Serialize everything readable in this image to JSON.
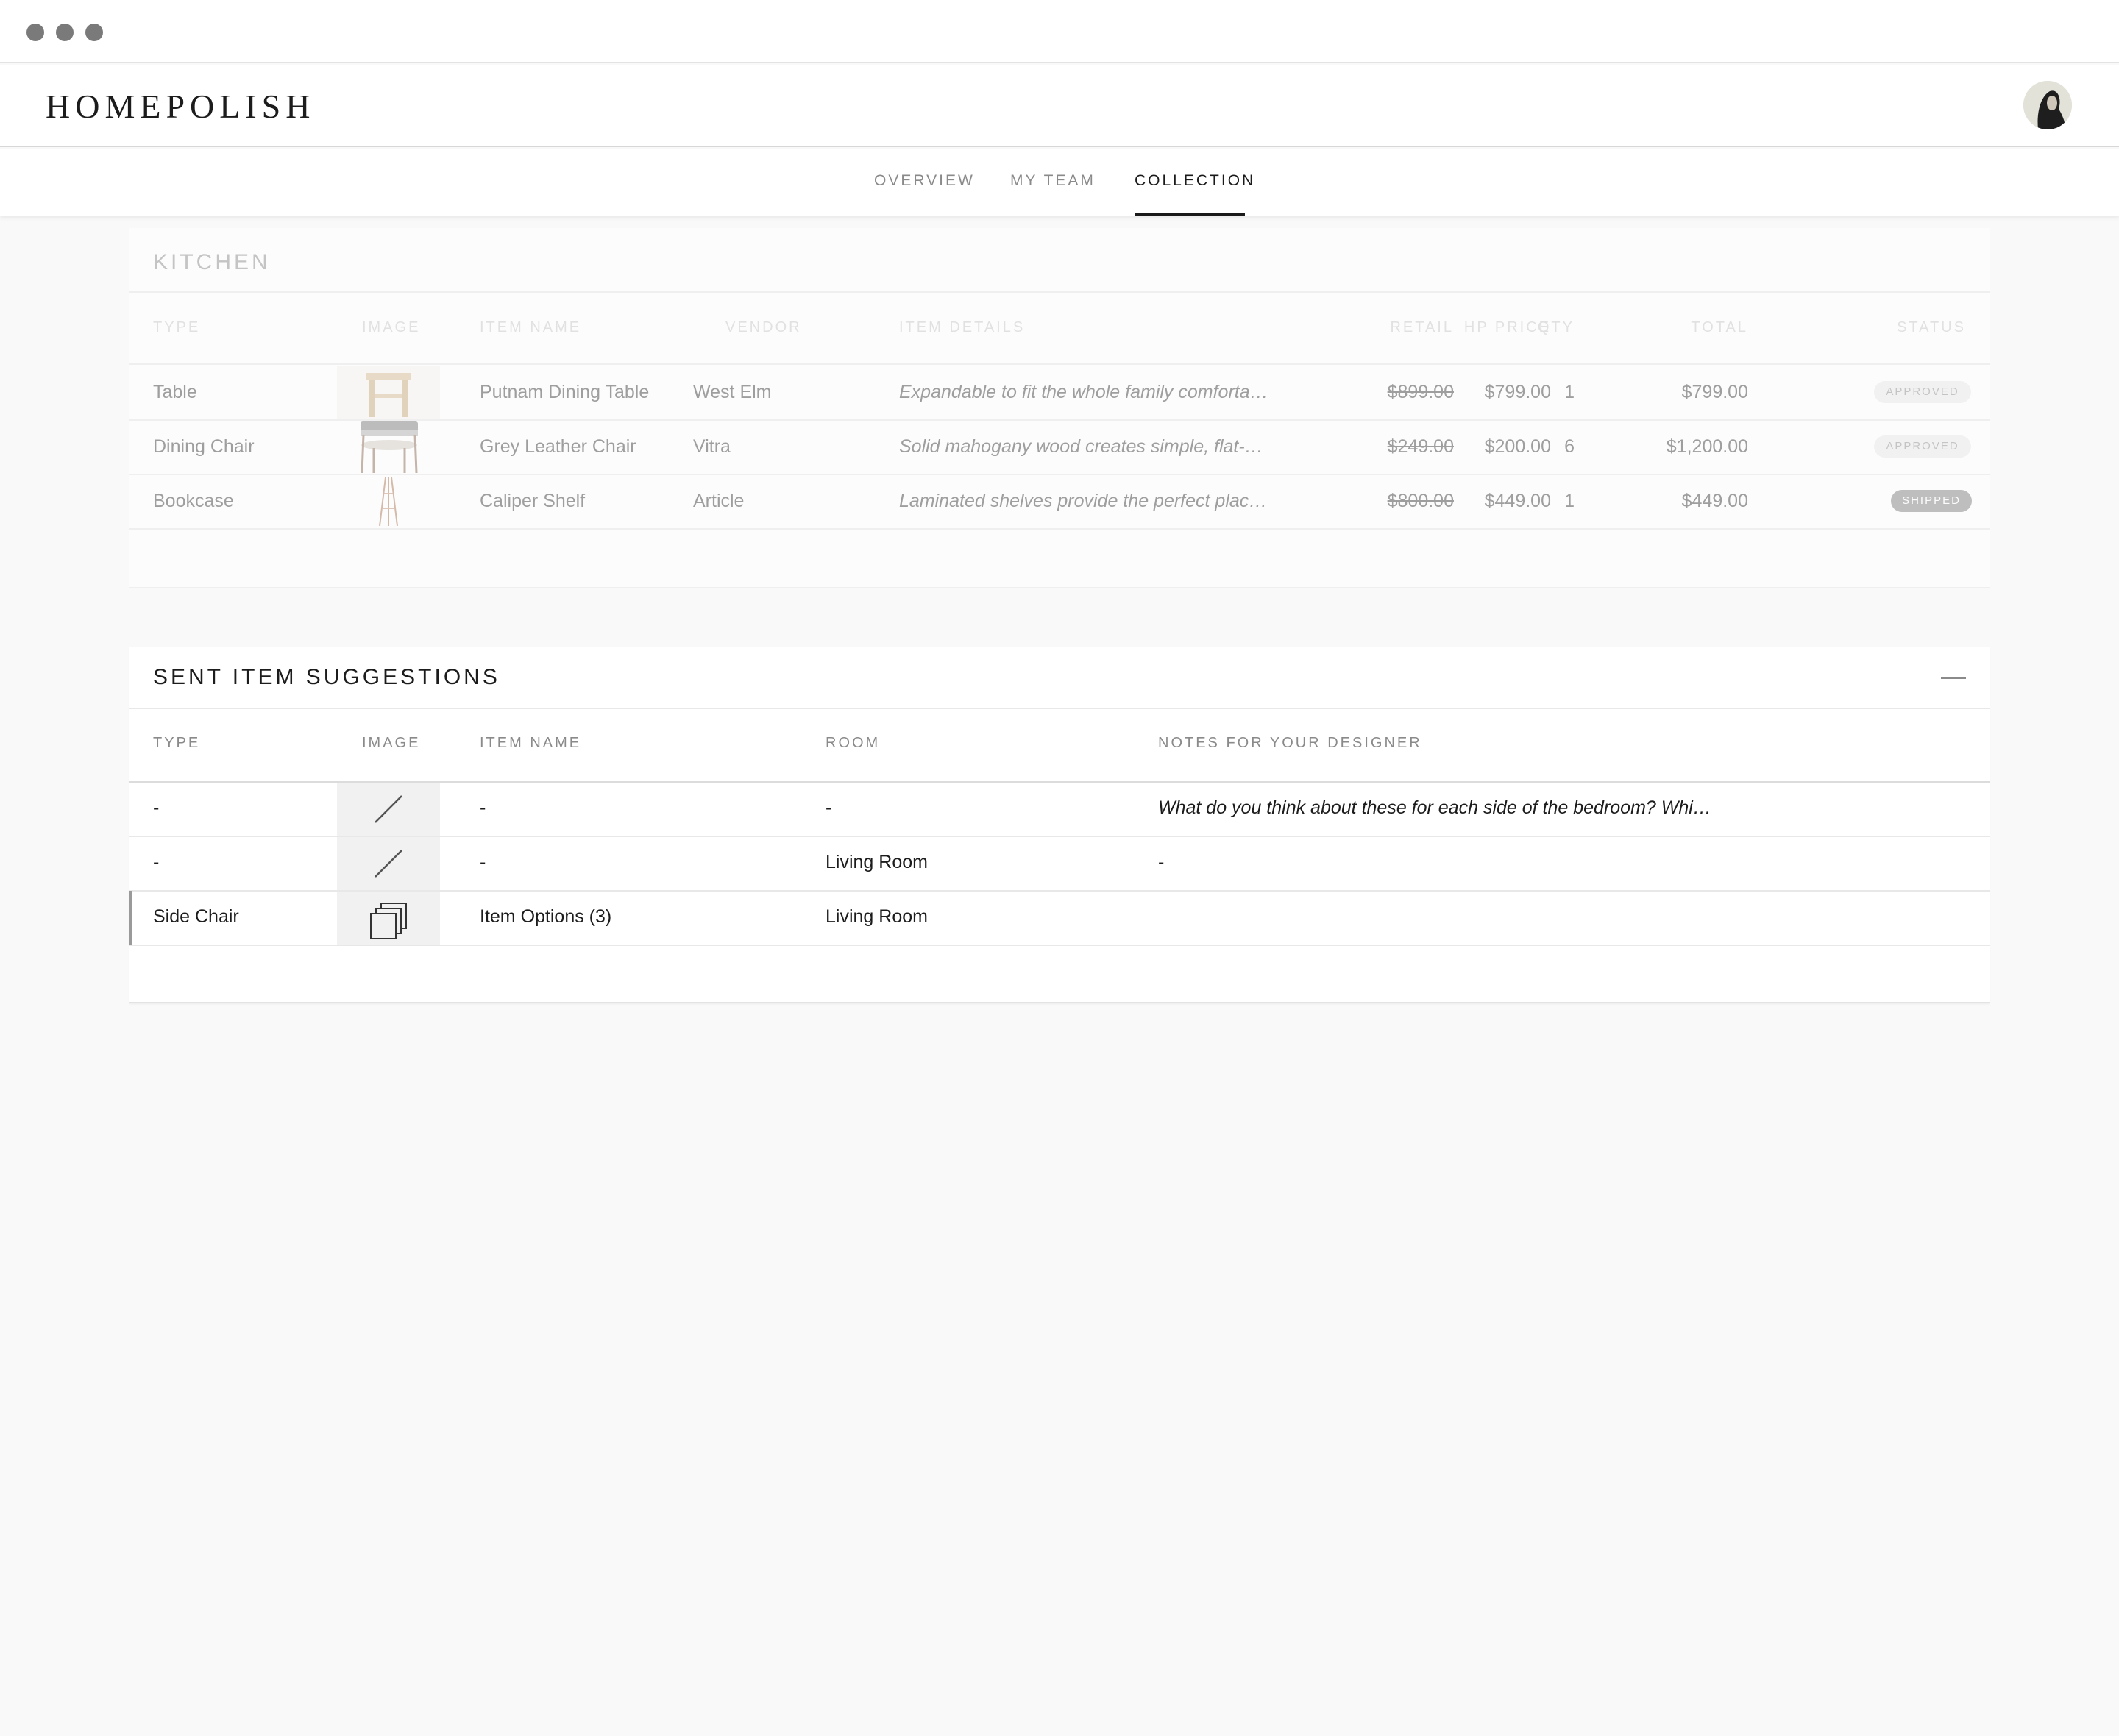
{
  "app": {
    "logo": "HOMEPOLISH"
  },
  "nav": {
    "tabs": [
      {
        "label": "OVERVIEW"
      },
      {
        "label": "MY TEAM"
      },
      {
        "label": "COLLECTION"
      }
    ],
    "active_tab": "COLLECTION"
  },
  "kitchen": {
    "title": "KITCHEN",
    "columns": [
      "TYPE",
      "IMAGE",
      "ITEM NAME",
      "VENDOR",
      "ITEM DETAILS",
      "RETAIL",
      "HP PRICE",
      "QTY",
      "TOTAL",
      "STATUS"
    ],
    "rows": [
      {
        "type": "Table",
        "image": "dining-table-thumbnail",
        "name": "Putnam Dining Table",
        "vendor": "West Elm",
        "details": "Expandable to fit the whole family comforta…",
        "retail": "$899.00",
        "hp_price": "$799.00",
        "qty": "1",
        "total": "$799.00",
        "status": "APPROVED"
      },
      {
        "type": "Dining Chair",
        "image": "chair-thumbnail",
        "name": "Grey Leather Chair",
        "vendor": "Vitra",
        "details": "Solid mahogany wood creates simple, flat-…",
        "retail": "$249.00",
        "hp_price": "$200.00",
        "qty": "6",
        "total": "$1,200.00",
        "status": "APPROVED"
      },
      {
        "type": "Bookcase",
        "image": "shelf-thumbnail",
        "name": "Caliper Shelf",
        "vendor": "Article",
        "details": "Laminated shelves provide the perfect plac…",
        "retail": "$800.00",
        "hp_price": "$449.00",
        "qty": "1",
        "total": "$449.00",
        "status": "SHIPPED"
      }
    ],
    "status_colors": {
      "APPROVED": "#ececec",
      "SHIPPED": "#8e8e8e"
    }
  },
  "sent": {
    "title": "SENT ITEM SUGGESTIONS",
    "columns": [
      "TYPE",
      "IMAGE",
      "ITEM NAME",
      "ROOM",
      "NOTES FOR YOUR DESIGNER"
    ],
    "rows": [
      {
        "type": "-",
        "image": "no-image-icon",
        "name": "-",
        "room": "-",
        "notes": "What do you think about these for each side of the bedroom? Whi…"
      },
      {
        "type": "-",
        "image": "no-image-icon",
        "name": "-",
        "room": "Living Room",
        "notes": "-"
      },
      {
        "type": "Side Chair",
        "image": "item-options-icon",
        "name": "Item Options (3)",
        "room": "Living Room",
        "notes": ""
      }
    ]
  }
}
